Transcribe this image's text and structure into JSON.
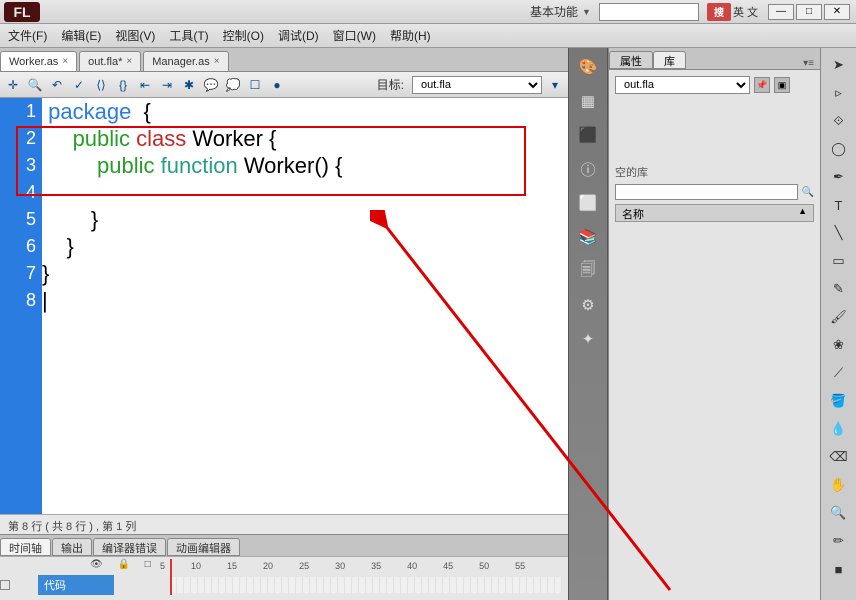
{
  "titlebar": {
    "app": "FL",
    "workspace_label": "基本功能",
    "ime_badge": "搜",
    "ime_text": "英 文",
    "search_placeholder": ""
  },
  "menu": {
    "items": [
      "文件(F)",
      "编辑(E)",
      "视图(V)",
      "工具(T)",
      "控制(O)",
      "调试(D)",
      "窗口(W)",
      "帮助(H)"
    ]
  },
  "doc_tabs": [
    {
      "label": "Worker.as",
      "close": "×",
      "active": true
    },
    {
      "label": "out.fla*",
      "close": "×",
      "active": false
    },
    {
      "label": "Manager.as",
      "close": "×",
      "active": false
    }
  ],
  "toolbar": {
    "target_label": "目标:",
    "target_value": "out.fla"
  },
  "code": {
    "line_numbers": [
      "1",
      "2",
      "3",
      "4",
      "5",
      "6",
      "7",
      "8"
    ],
    "l1_kw": "package",
    "l1_b": "  {",
    "l2_kw1": "public",
    "l2_kw2": "class",
    "l2_id": "Worker",
    "l2_b": "{",
    "l3_kw1": "public",
    "l3_kw2": "function",
    "l3_id": "Worker",
    "l3_rest": "() {",
    "l5": "        }",
    "l6": "    }",
    "l7": "}",
    "l8": "|"
  },
  "status": "第 8 行 ( 共 8 行 ) , 第 1 列",
  "bottom_tabs": [
    "时间轴",
    "输出",
    "编译器错误",
    "动画编辑器"
  ],
  "timeline": {
    "frames": [
      "5",
      "10",
      "15",
      "20",
      "25",
      "30",
      "35",
      "40",
      "45",
      "50",
      "55"
    ],
    "layer": "代码"
  },
  "panel": {
    "tabs": [
      "属性",
      "库"
    ],
    "lib_file": "out.fla",
    "empty_label": "空的库",
    "name_header": "名称"
  }
}
